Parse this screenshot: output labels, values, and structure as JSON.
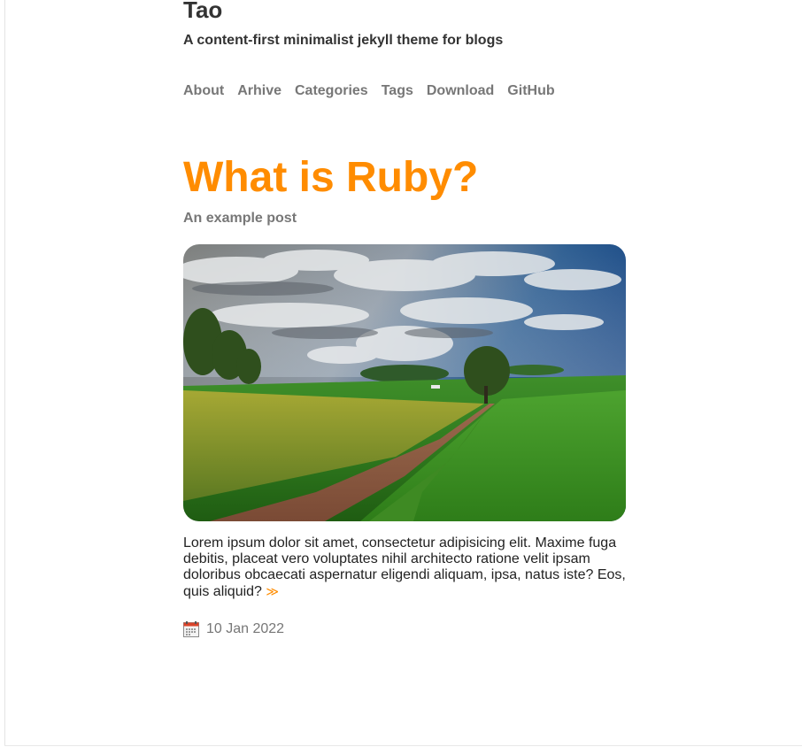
{
  "site": {
    "title": "Tao",
    "description": "A content-first minimalist jekyll theme for blogs"
  },
  "nav": {
    "items": [
      {
        "label": "About"
      },
      {
        "label": "Arhive"
      },
      {
        "label": "Categories"
      },
      {
        "label": "Tags"
      },
      {
        "label": "Download"
      },
      {
        "label": "GitHub"
      }
    ]
  },
  "post": {
    "title": "What is Ruby?",
    "subtitle": "An example post",
    "image_alt": "Green countryside landscape with a dirt path, fields and cloudy sky",
    "excerpt": "Lorem ipsum dolor sit amet, consectetur adipisicing elit. Maxime fuga debitis, placeat vero voluptates nihil architecto ratione velit ipsam doloribus obcaecati aspernatur eligendi aliquam, ipsa, natus iste? Eos, quis aliquid?",
    "read_more_glyph": "≫",
    "date": "10 Jan 2022",
    "date_icon": "calendar-icon"
  },
  "colors": {
    "accent": "#ff8c00",
    "muted_text": "#777777",
    "body_text": "#333333"
  }
}
